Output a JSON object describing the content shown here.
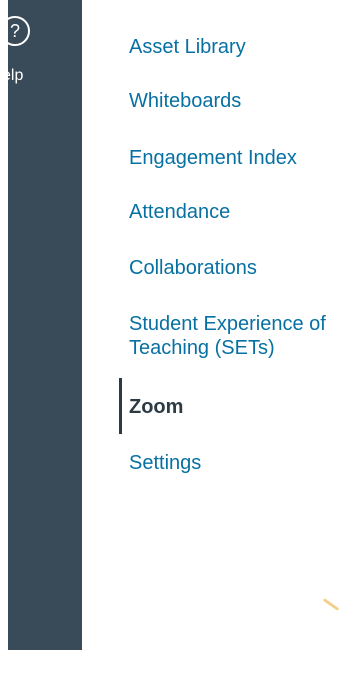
{
  "global_nav": {
    "help": {
      "icon": "question-circle-icon",
      "icon_glyph": "?",
      "label": "elp"
    }
  },
  "course_nav": {
    "items": [
      {
        "label": "Asset Library",
        "active": false
      },
      {
        "label": "Whiteboards",
        "active": false
      },
      {
        "label": "Engagement Index",
        "active": false
      },
      {
        "label": "Attendance",
        "active": false
      },
      {
        "label": "Collaborations",
        "active": false
      },
      {
        "label": "Student Experience of Teaching (SETs)",
        "active": false
      },
      {
        "label": "Zoom",
        "active": true
      },
      {
        "label": "Settings",
        "active": false
      }
    ]
  },
  "colors": {
    "global_nav_bg": "#394b58",
    "link": "#0770a3",
    "active_text": "#2d3b45"
  }
}
